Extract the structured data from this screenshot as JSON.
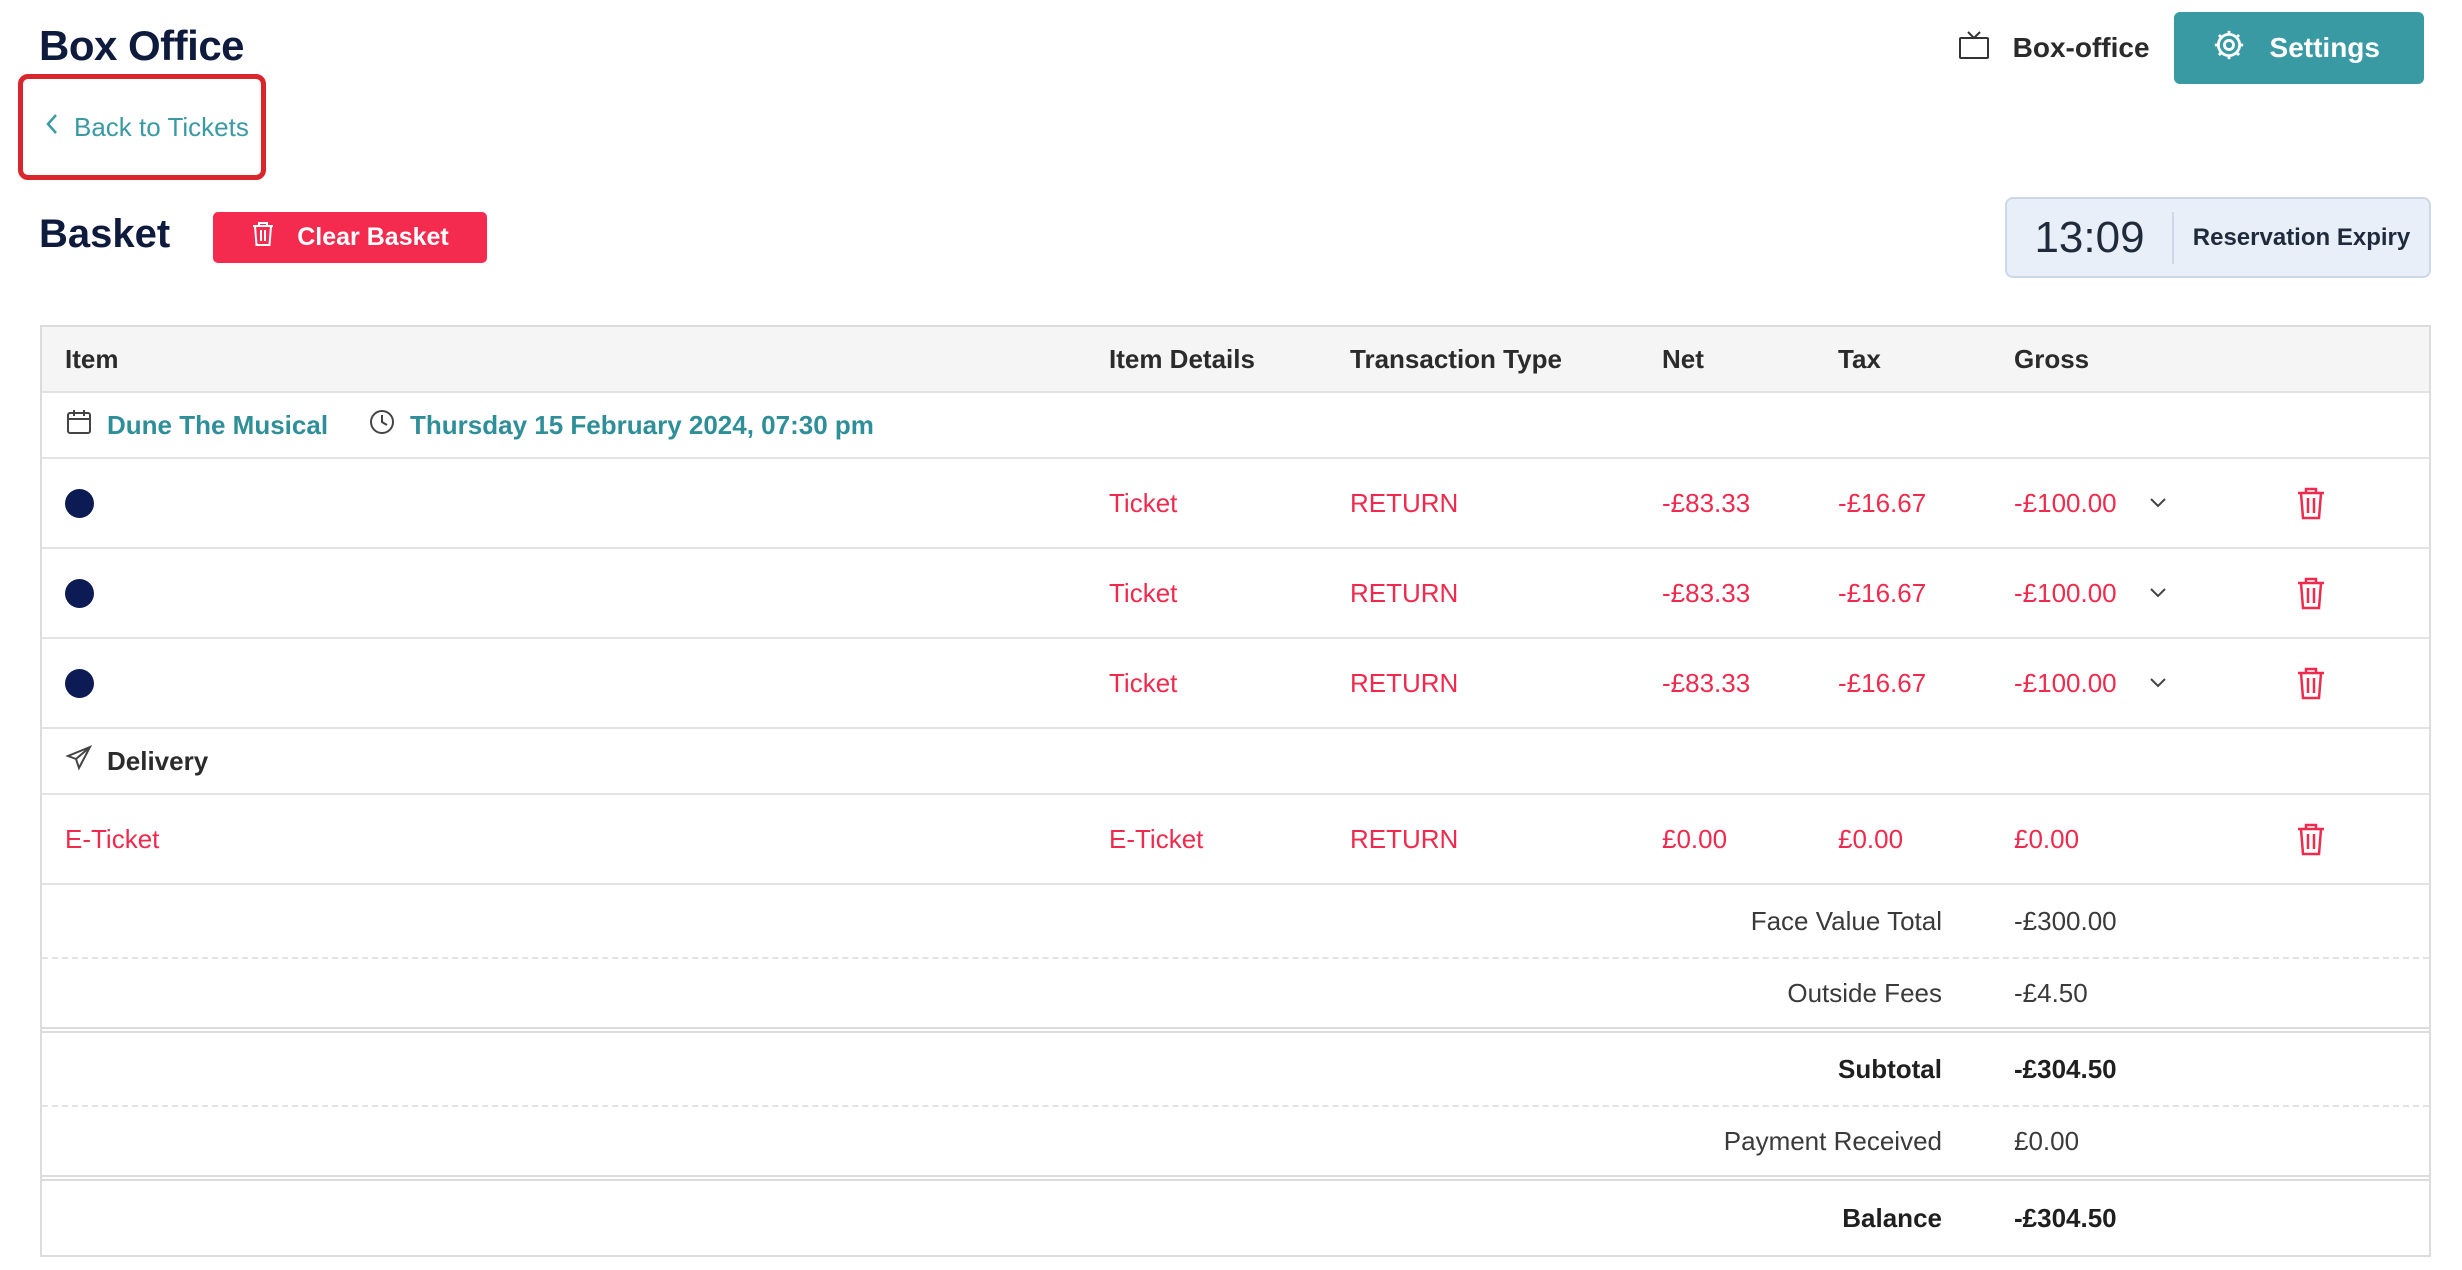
{
  "header": {
    "app_title": "Box Office",
    "context_label": "Box-office",
    "settings_label": "Settings"
  },
  "back_link": {
    "label": "Back to Tickets"
  },
  "basket": {
    "title": "Basket",
    "clear_label": "Clear Basket",
    "expiry_time": "13:09",
    "expiry_label": "Reservation Expiry"
  },
  "table": {
    "columns": [
      "Item",
      "Item Details",
      "Transaction Type",
      "Net",
      "Tax",
      "Gross"
    ],
    "performance": {
      "title": "Dune The Musical",
      "datetime": "Thursday 15 February 2024, 07:30 pm"
    },
    "tickets": [
      {
        "details": "Ticket",
        "type": "RETURN",
        "net": "-£83.33",
        "tax": "-£16.67",
        "gross": "-£100.00"
      },
      {
        "details": "Ticket",
        "type": "RETURN",
        "net": "-£83.33",
        "tax": "-£16.67",
        "gross": "-£100.00"
      },
      {
        "details": "Ticket",
        "type": "RETURN",
        "net": "-£83.33",
        "tax": "-£16.67",
        "gross": "-£100.00"
      }
    ],
    "delivery": {
      "title": "Delivery",
      "item": "E-Ticket",
      "details": "E-Ticket",
      "type": "RETURN",
      "net": "£0.00",
      "tax": "£0.00",
      "gross": "£0.00"
    },
    "summary": {
      "face_value_label": "Face Value Total",
      "face_value": "-£300.00",
      "outside_fees_label": "Outside Fees",
      "outside_fees": "-£4.50",
      "subtotal_label": "Subtotal",
      "subtotal": "-£304.50",
      "payment_label": "Payment Received",
      "payment": "£0.00",
      "balance_label": "Balance",
      "balance": "-£304.50"
    }
  },
  "colors": {
    "teal": "#3a9aa3",
    "red": "#f02a4d",
    "navy": "#0f1b3d",
    "highlight": "#d9262c"
  },
  "icons": {
    "context": "tv-icon",
    "settings": "gear-icon",
    "back": "chevron-left-icon",
    "clear": "trash-icon",
    "performance": "calendar-icon",
    "time": "clock-icon",
    "row_expand": "chevron-down-icon",
    "row_delete": "trash-icon",
    "delivery": "paper-plane-icon"
  }
}
